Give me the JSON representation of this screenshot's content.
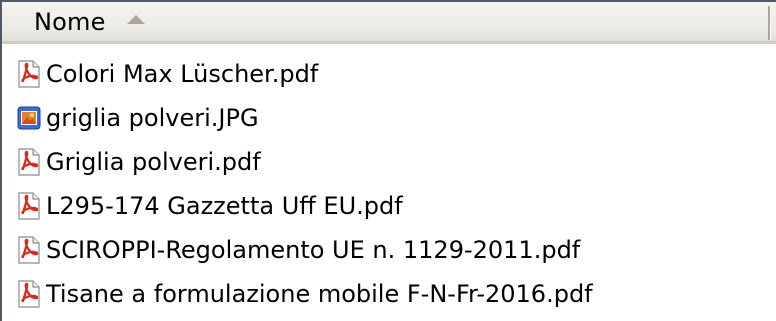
{
  "column_header": {
    "label": "Nome",
    "sort_indicator": "sort-ascending-icon"
  },
  "colors": {
    "header_bg": "#ebeae4",
    "sort_arrow": "#aca899",
    "pdf_icon_red": "#d9281e",
    "jpg_icon_blue": "#3b6bd6",
    "jpg_icon_orange": "#e8822a"
  },
  "files": [
    {
      "name": "Colori Max Lüscher.pdf",
      "icon": "pdf-file-icon"
    },
    {
      "name": "griglia polveri.JPG",
      "icon": "image-file-icon"
    },
    {
      "name": "Griglia polveri.pdf",
      "icon": "pdf-file-icon"
    },
    {
      "name": "L295-174 Gazzetta Uff EU.pdf",
      "icon": "pdf-file-icon"
    },
    {
      "name": "SCIROPPI-Regolamento UE n. 1129-2011.pdf",
      "icon": "pdf-file-icon"
    },
    {
      "name": "Tisane a formulazione mobile F-N-Fr-2016.pdf",
      "icon": "pdf-file-icon"
    }
  ]
}
